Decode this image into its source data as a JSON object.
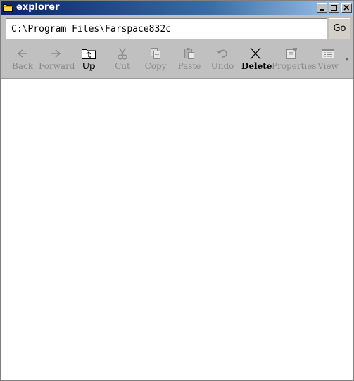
{
  "window": {
    "title": "explorer",
    "title_icon": "folder-icon",
    "controls": [
      "minimize-icon",
      "maximize-icon",
      "close-icon"
    ]
  },
  "address": {
    "value": "C:\\Program Files\\Farspace832c",
    "go_label": "Go"
  },
  "toolbar": {
    "buttons": [
      {
        "label": "Back",
        "icon": "back-arrow-icon",
        "enabled": false
      },
      {
        "label": "Forward",
        "icon": "forward-arrow-icon",
        "enabled": false
      },
      {
        "label": "Up",
        "icon": "up-folder-icon",
        "enabled": true
      },
      {
        "label": "Cut",
        "icon": "scissors-icon",
        "enabled": false
      },
      {
        "label": "Copy",
        "icon": "copy-icon",
        "enabled": false
      },
      {
        "label": "Paste",
        "icon": "paste-icon",
        "enabled": false
      },
      {
        "label": "Undo",
        "icon": "undo-icon",
        "enabled": false
      },
      {
        "label": "Delete",
        "icon": "delete-x-icon",
        "enabled": true
      },
      {
        "label": "Properties",
        "icon": "properties-icon",
        "enabled": false
      },
      {
        "label": "View",
        "icon": "view-icon",
        "enabled": false
      }
    ],
    "overflow_icon": "chevron-down-icon"
  },
  "colors": {
    "titlebar_start": "#0a246a",
    "titlebar_end": "#a6caf0",
    "chrome": "#c0c0c0",
    "disabled_text": "#8a8a8a"
  }
}
